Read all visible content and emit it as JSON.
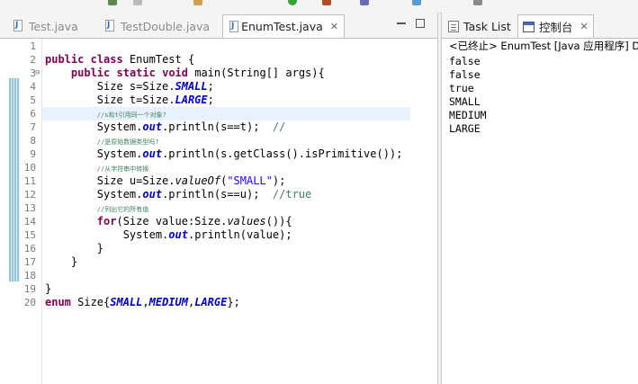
{
  "editor": {
    "tabs": [
      {
        "label": "Test.java"
      },
      {
        "label": "TestDouble.java"
      },
      {
        "label": "EnumTest.java",
        "close": "✕"
      }
    ],
    "lines": [
      {
        "num": "1",
        "code": ""
      },
      {
        "num": "2",
        "code": "public class EnumTest {"
      },
      {
        "num": "3",
        "code": "    public static void main(String[] args){"
      },
      {
        "num": "4",
        "code": "        Size s=Size.SMALL;"
      },
      {
        "num": "5",
        "code": "        Size t=Size.LARGE;"
      },
      {
        "num": "6",
        "code": "        //s和t引用同一个对象?"
      },
      {
        "num": "7",
        "code": "        System.out.println(s==t);  //"
      },
      {
        "num": "8",
        "code": "        //是原始数据类型吗?"
      },
      {
        "num": "9",
        "code": "        System.out.println(s.getClass().isPrimitive());"
      },
      {
        "num": "10",
        "code": "        //从字符串中转换"
      },
      {
        "num": "11",
        "code": "        Size u=Size.valueOf(\"SMALL\");"
      },
      {
        "num": "12",
        "code": "        System.out.println(s==u);  //true"
      },
      {
        "num": "13",
        "code": "        //列出它的所有值"
      },
      {
        "num": "14",
        "code": "        for(Size value:Size.values()){"
      },
      {
        "num": "15",
        "code": "            System.out.println(value);"
      },
      {
        "num": "16",
        "code": "        }"
      },
      {
        "num": "17",
        "code": "    }"
      },
      {
        "num": "18",
        "code": ""
      },
      {
        "num": "19",
        "code": "}"
      },
      {
        "num": "20",
        "code": "enum Size{SMALL,MEDIUM,LARGE};"
      }
    ]
  },
  "console": {
    "tabs": [
      {
        "label": "Task List"
      },
      {
        "label": "控制台",
        "close": "✕"
      }
    ],
    "status": "<已终止> EnumTest [Java 应用程序] D",
    "output": [
      "false",
      "false",
      "true",
      "SMALL",
      "MEDIUM",
      "LARGE"
    ]
  }
}
